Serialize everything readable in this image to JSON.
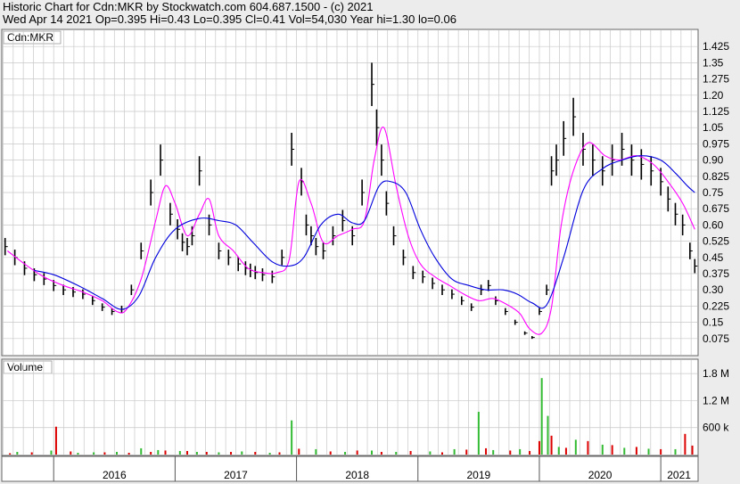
{
  "header": {
    "line1": "Historic Chart for Cdn:MKR by Stockwatch.com 604.687.1500 - (c) 2021",
    "line2": "Wed Apr 14 2021  Op=0.395  Hi=0.43  Lo=0.395  Cl=0.41  Vol=54,030  Year hi=1.30  lo=0.06"
  },
  "chart_data": [
    {
      "type": "line",
      "panel": "price",
      "legend_label": "Cdn:MKR",
      "y_ticks": [
        0.075,
        0.15,
        0.225,
        0.3,
        0.375,
        0.45,
        0.525,
        0.6,
        0.675,
        0.75,
        0.825,
        0.9,
        0.975,
        1.05,
        1.125,
        1.2,
        1.275,
        1.35,
        1.425
      ],
      "y_tick_labels": [
        "0.075",
        "0.15",
        "0.225",
        "0.30",
        "0.375",
        "0.45",
        "0.525",
        "0.60",
        "0.675",
        "0.75",
        "0.825",
        "0.90",
        "0.975",
        "1.05",
        "1.125",
        "1.20",
        "1.275",
        "1.35",
        "1.425"
      ],
      "ylim": [
        0.0,
        1.5
      ],
      "x_labels": [
        "2016",
        "2017",
        "2018",
        "2019",
        "2020",
        "2021"
      ],
      "xlim": [
        2015.58,
        2021.3
      ],
      "x_year_starts": [
        2016,
        2017,
        2018,
        2019,
        2020,
        2021
      ],
      "grid": true,
      "series": [
        {
          "color": "#000000",
          "style": "ohlc_bars",
          "x": [
            2015.6,
            2015.68,
            2015.76,
            2015.84,
            2015.92,
            2016.0,
            2016.08,
            2016.16,
            2016.24,
            2016.32,
            2016.4,
            2016.48,
            2016.56,
            2016.64,
            2016.72,
            2016.8,
            2016.88,
            2016.96,
            2017.02,
            2017.06,
            2017.1,
            2017.14,
            2017.2,
            2017.28,
            2017.36,
            2017.44,
            2017.52,
            2017.58,
            2017.62,
            2017.66,
            2017.72,
            2017.8,
            2017.88,
            2017.96,
            2018.04,
            2018.08,
            2018.12,
            2018.16,
            2018.22,
            2018.3,
            2018.38,
            2018.46,
            2018.54,
            2018.62,
            2018.66,
            2018.7,
            2018.74,
            2018.8,
            2018.88,
            2018.96,
            2019.04,
            2019.12,
            2019.2,
            2019.28,
            2019.36,
            2019.44,
            2019.52,
            2019.58,
            2019.64,
            2019.72,
            2019.8,
            2019.88,
            2019.94,
            2020.0,
            2020.06,
            2020.1,
            2020.14,
            2020.2,
            2020.28,
            2020.36,
            2020.44,
            2020.52,
            2020.6,
            2020.68,
            2020.76,
            2020.84,
            2020.92,
            2021.0,
            2021.06,
            2021.12,
            2021.18,
            2021.24,
            2021.28
          ],
          "y": [
            0.5,
            0.45,
            0.4,
            0.37,
            0.35,
            0.32,
            0.3,
            0.29,
            0.28,
            0.25,
            0.22,
            0.2,
            0.21,
            0.3,
            0.48,
            0.75,
            0.9,
            0.65,
            0.58,
            0.52,
            0.5,
            0.55,
            0.85,
            0.6,
            0.48,
            0.45,
            0.42,
            0.4,
            0.39,
            0.38,
            0.37,
            0.36,
            0.45,
            0.95,
            0.8,
            0.6,
            0.55,
            0.5,
            0.48,
            0.55,
            0.62,
            0.55,
            0.75,
            1.25,
            1.05,
            0.9,
            0.7,
            0.55,
            0.45,
            0.38,
            0.36,
            0.33,
            0.3,
            0.28,
            0.25,
            0.22,
            0.3,
            0.32,
            0.25,
            0.2,
            0.15,
            0.1,
            0.08,
            0.2,
            0.3,
            0.85,
            0.9,
            1.0,
            1.1,
            0.95,
            0.9,
            0.85,
            0.9,
            0.95,
            0.9,
            0.88,
            0.85,
            0.8,
            0.72,
            0.65,
            0.6,
            0.48,
            0.41
          ]
        },
        {
          "color": "#ff00ff",
          "style": "line",
          "smoothing": "short",
          "x": [
            2015.62,
            2015.76,
            2015.92,
            2016.08,
            2016.24,
            2016.4,
            2016.52,
            2016.6,
            2016.72,
            2016.84,
            2016.92,
            2017.0,
            2017.1,
            2017.2,
            2017.28,
            2017.36,
            2017.48,
            2017.6,
            2017.72,
            2017.84,
            2017.94,
            2018.02,
            2018.12,
            2018.22,
            2018.34,
            2018.46,
            2018.56,
            2018.64,
            2018.72,
            2018.82,
            2018.92,
            2019.02,
            2019.14,
            2019.26,
            2019.38,
            2019.5,
            2019.62,
            2019.74,
            2019.84,
            2019.92,
            2020.02,
            2020.1,
            2020.18,
            2020.28,
            2020.4,
            2020.54,
            2020.66,
            2020.8,
            2020.94,
            2021.06,
            2021.18,
            2021.28
          ],
          "y": [
            0.48,
            0.42,
            0.36,
            0.32,
            0.29,
            0.25,
            0.2,
            0.21,
            0.35,
            0.62,
            0.78,
            0.7,
            0.55,
            0.65,
            0.72,
            0.55,
            0.48,
            0.4,
            0.38,
            0.38,
            0.44,
            0.8,
            0.7,
            0.52,
            0.55,
            0.58,
            0.62,
            0.9,
            1.05,
            0.78,
            0.55,
            0.42,
            0.36,
            0.32,
            0.28,
            0.25,
            0.26,
            0.23,
            0.19,
            0.12,
            0.1,
            0.22,
            0.6,
            0.85,
            0.98,
            0.92,
            0.9,
            0.92,
            0.88,
            0.8,
            0.7,
            0.58
          ]
        },
        {
          "color": "#0000dd",
          "style": "line",
          "smoothing": "long",
          "x": [
            2015.84,
            2016.0,
            2016.2,
            2016.4,
            2016.56,
            2016.7,
            2016.84,
            2017.0,
            2017.2,
            2017.36,
            2017.5,
            2017.64,
            2017.8,
            2017.94,
            2018.06,
            2018.2,
            2018.34,
            2018.46,
            2018.56,
            2018.68,
            2018.78,
            2018.9,
            2019.02,
            2019.14,
            2019.28,
            2019.42,
            2019.56,
            2019.7,
            2019.82,
            2019.94,
            2020.06,
            2020.2,
            2020.36,
            2020.52,
            2020.68,
            2020.84,
            2021.0,
            2021.12,
            2021.22,
            2021.28
          ],
          "y": [
            0.39,
            0.37,
            0.32,
            0.26,
            0.21,
            0.27,
            0.45,
            0.58,
            0.63,
            0.62,
            0.6,
            0.52,
            0.43,
            0.41,
            0.45,
            0.6,
            0.65,
            0.61,
            0.62,
            0.78,
            0.8,
            0.75,
            0.58,
            0.45,
            0.35,
            0.32,
            0.3,
            0.3,
            0.28,
            0.24,
            0.23,
            0.45,
            0.76,
            0.86,
            0.9,
            0.92,
            0.9,
            0.84,
            0.78,
            0.75
          ]
        }
      ]
    },
    {
      "type": "bar",
      "panel": "volume",
      "legend_label": "Volume",
      "y_ticks": [
        600000,
        1200000,
        1800000
      ],
      "y_tick_labels": [
        "600 k",
        "1.2 M",
        "1.8 M"
      ],
      "ylim": [
        0,
        2100000
      ],
      "xlim": [
        2015.58,
        2021.3
      ],
      "series": [
        {
          "name": "up",
          "color": "#33bb33",
          "x": [
            2015.7,
            2015.98,
            2016.2,
            2016.33,
            2016.52,
            2016.72,
            2016.86,
            2017.04,
            2017.18,
            2017.36,
            2017.55,
            2017.78,
            2017.96,
            2018.16,
            2018.4,
            2018.62,
            2018.82,
            2019.1,
            2019.3,
            2019.5,
            2019.62,
            2019.84,
            2020.02,
            2020.07,
            2020.16,
            2020.3,
            2020.52,
            2020.7,
            2020.9,
            2021.12
          ],
          "y": [
            60000,
            90000,
            40000,
            50000,
            60000,
            140000,
            100000,
            80000,
            60000,
            50000,
            70000,
            40000,
            760000,
            120000,
            60000,
            90000,
            60000,
            70000,
            120000,
            950000,
            100000,
            120000,
            1700000,
            860000,
            170000,
            330000,
            220000,
            150000,
            130000,
            120000
          ]
        },
        {
          "name": "down",
          "color": "#dd0000",
          "x": [
            2015.64,
            2015.82,
            2016.02,
            2016.14,
            2016.42,
            2016.62,
            2016.8,
            2016.92,
            2017.1,
            2017.26,
            2017.46,
            2017.66,
            2017.86,
            2018.02,
            2018.28,
            2018.5,
            2018.7,
            2018.94,
            2019.2,
            2019.4,
            2019.56,
            2019.76,
            2019.92,
            2020.0,
            2020.1,
            2020.22,
            2020.4,
            2020.6,
            2020.8,
            2021.0,
            2021.2,
            2021.26
          ],
          "y": [
            30000,
            50000,
            620000,
            70000,
            50000,
            40000,
            60000,
            90000,
            80000,
            60000,
            60000,
            60000,
            50000,
            130000,
            70000,
            90000,
            60000,
            80000,
            50000,
            110000,
            140000,
            90000,
            80000,
            300000,
            420000,
            150000,
            300000,
            210000,
            170000,
            120000,
            460000,
            200000
          ]
        }
      ]
    }
  ]
}
